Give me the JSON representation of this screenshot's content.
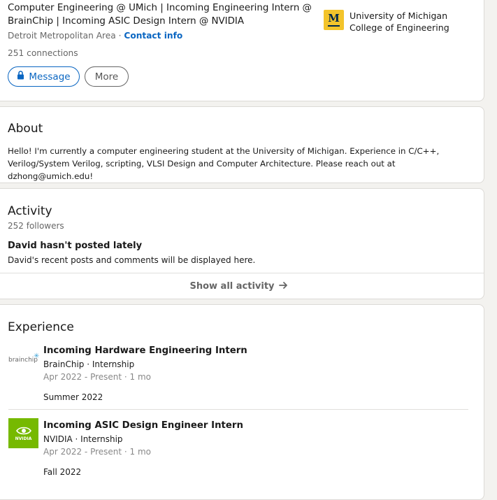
{
  "top": {
    "headline_line1": "Computer Engineering @ UMich | Incoming Engineering Intern @",
    "headline_line2": "BrainChip | Incoming ASIC Design Intern @ NVIDIA",
    "location": "Detroit Metropolitan Area",
    "location_sep": " · ",
    "contact_info": "Contact info",
    "connections": "251 connections",
    "message_label": "Message",
    "more_label": "More",
    "school": {
      "line1": "University of Michigan",
      "line2": "College of Engineering",
      "logo_letter": "M"
    }
  },
  "about": {
    "title": "About",
    "line1": "Hello! I'm currently a computer engineering student at the University of Michigan. Experience in C/C++,",
    "line2": "Verilog/System Verilog, scripting, VLSI Design and Computer Architecture. Please reach out at dzhong@umich.edu!"
  },
  "activity": {
    "title": "Activity",
    "followers": "252 followers",
    "no_posts_title": "David hasn't posted lately",
    "no_posts_text": "David's recent posts and comments will be displayed here.",
    "show_all": "Show all activity"
  },
  "experience": {
    "title": "Experience",
    "items": [
      {
        "logo_text": "brainchip",
        "role": "Incoming Hardware Engineering Intern",
        "company": "BrainChip · Internship",
        "dates": "Apr 2022 - Present · 1 mo",
        "description": "Summer 2022"
      },
      {
        "logo_text": "NVIDIA",
        "role": "Incoming ASIC Design Engineer Intern",
        "company": "NVIDIA · Internship",
        "dates": "Apr 2022 - Present · 1 mo",
        "description": "Fall 2022"
      }
    ]
  },
  "colors": {
    "link": "#0a66c2",
    "page_bg": "#f3f2ef",
    "umich_maize": "#f3c42b",
    "umich_blue": "#00274c",
    "nvidia_green": "#76b900"
  }
}
